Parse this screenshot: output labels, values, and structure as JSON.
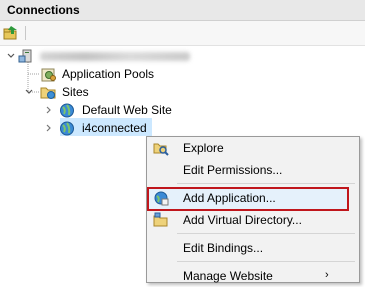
{
  "panel": {
    "title": "Connections"
  },
  "tree": {
    "server_label": "",
    "nodes": [
      {
        "label": "Application Pools"
      },
      {
        "label": "Sites"
      },
      {
        "label": "Default Web Site"
      },
      {
        "label": "i4connected"
      }
    ]
  },
  "context_menu": {
    "items": [
      {
        "label": "Explore",
        "icon": "explore-icon"
      },
      {
        "label": "Edit Permissions..."
      },
      {
        "label": "Add Application...",
        "icon": "add-application-icon",
        "highlighted": true
      },
      {
        "label": "Add Virtual Directory...",
        "icon": "add-virtual-directory-icon"
      },
      {
        "label": "Edit Bindings..."
      },
      {
        "label": "Manage Website"
      }
    ],
    "submenu_arrow": "›"
  },
  "colors": {
    "highlight_border": "#c0161c",
    "selection": "#cce8ff"
  }
}
